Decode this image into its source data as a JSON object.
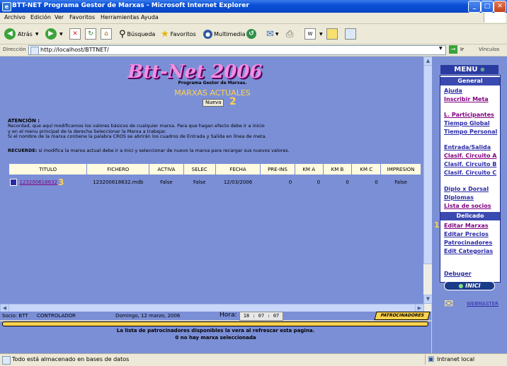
{
  "window": {
    "title": "BTT-NET Programa Gestor de Marxas - Microsoft Internet Explorer",
    "minimize": "_",
    "maximize": "□",
    "close": "✕"
  },
  "menubar": [
    "Archivo",
    "Edición",
    "Ver",
    "Favoritos",
    "Herramientas",
    "Ayuda"
  ],
  "toolbar": {
    "back": "Atrás",
    "search": "Búsqueda",
    "favorites": "Favoritos",
    "multimedia": "Multimedia"
  },
  "address": {
    "label": "Dirección",
    "url": "http://localhost/BTTNET/",
    "go": "Ir",
    "links": "Vínculos"
  },
  "page": {
    "logo": "Btt-Net 2006",
    "subtitle": "Programa Gestor de Marxas.",
    "heading": "MARXAS ACTUALES",
    "new_button": "Nueva",
    "marker_new": "2",
    "attention_title": "ATENCIÓN :",
    "attention_lines": [
      "Recordad, que aquí modificamos los valores básicos de cualquier marxa. Para que hagan efecto debe ir a inicio",
      "y en el menu principal de la derecha Seleccionar la Marxa a trabajar.",
      "Si el nombre de la marxa contiene la palabra CROS se abrirán los cuadros de Entrada y Salida en línea de meta."
    ],
    "remember_label": "RECUERDE:",
    "remember_text": "si modifica la marxa actual debe ir a Inici y seleccionar de nuevo la marxa para recargar sus nuevos valores.",
    "table": {
      "headers": [
        "TITULO",
        "FICHERO",
        "ACTIVA",
        "SELEC",
        "FECHA",
        "PRE-INS",
        "KM A",
        "KM B",
        "KM C",
        "IMPRESION"
      ],
      "rows": [
        [
          "123200618632",
          "123200618632.mdb",
          "False",
          "False",
          "12/03/2006",
          "0",
          "0",
          "0",
          "0",
          "False"
        ]
      ],
      "marker_title": "3"
    }
  },
  "right_menu": {
    "title": "MENU",
    "section_general": "General",
    "general_items": [
      "Ajuda",
      "Inscribir Meta",
      "L. Participantes",
      "Tiempo Global",
      "Tiempo Personal",
      "Entrada/Salida",
      "Clasif. Circuito A",
      "Clasif. Circuito B",
      "Clasif. Circuito C",
      "Diplo x Dorsal",
      "Diplomas",
      "Lista de socios"
    ],
    "section_delicado": "Delicado",
    "delicado_items": [
      "Editar Marxas",
      "Editar Precios",
      "Patrocinadores",
      "Edit Categorias"
    ],
    "marker_editar": "1",
    "debuger": "Debuger",
    "inici": "INICI",
    "webmaster": "WEBMASTER"
  },
  "footer": {
    "socio": "Socio: BTT",
    "role": "CONTROLADOR",
    "date": "Domingo, 12 marzo, 2006",
    "hora_label": "Hora:",
    "hora": "18 : 07 : 07",
    "patrocinadores": "PATROCINADORES",
    "msg1": "La lista de patrocinadores disponibles la vera al refrescar esta pagina.",
    "msg2": "0 no hay marxa seleccionada"
  },
  "statusbar": {
    "left": "Todo está almacenado en bases de datos",
    "right": "Intranet local"
  },
  "colors": {
    "page_bg": "#7b8fd6",
    "accent_yellow": "#ffd24d",
    "menu_header": "#3b4ab0"
  }
}
